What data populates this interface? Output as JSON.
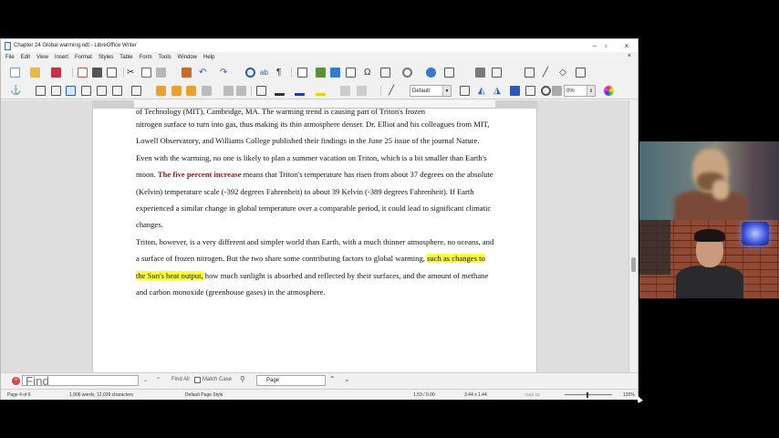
{
  "window": {
    "title": "Chapter 24 Global warming.odt - LibreOffice Writer"
  },
  "menu": [
    "File",
    "Edit",
    "View",
    "Insert",
    "Format",
    "Styles",
    "Table",
    "Form",
    "Tools",
    "Window",
    "Help"
  ],
  "toolbar": {
    "paragraph_style": "Default",
    "zoom_value": "0%"
  },
  "document": {
    "line_cut": "of Technology (MIT), Cambridge, MA. The warming trend is causing part of Triton's frozen",
    "p1": "nitrogen surface to turn into gas, thus making its thin atmosphere denser. Dr. Elliot and his colleagues from MIT, Lowell Observatory, and Williams College published their findings in the June 25 issue of the journal Nature.",
    "p2_a": "Even with the warming, no one is likely to plan a summer vacation on Triton, which is a bit smaller than Earth's moon. ",
    "p2_bold": "The five percent increase",
    "p2_b": " means that Triton's temperature has risen from about 37 degrees on the absolute (Kelvin) temperature scale (-392 degrees Fahrenheit) to about 39 Kelvin (-389 degrees Fahrenheit). If Earth experienced a similar change in global temperature over a comparable period, it could lead to significant climatic changes.",
    "p3_a": "Triton, however, is a very different and simpler world than Earth, with a much thinner atmosphere, no oceans, and a surface of frozen nitrogen. But the two share some contributing factors to global warming, ",
    "p3_hl": "such as changes to the Sun's heat output,",
    "p3_b": " how much sunlight is absorbed and reflected by their surfaces, and the amount of methane and carbon monoxide (greenhouse gases) in the atmosphere."
  },
  "findbar": {
    "placeholder": "Find",
    "find_all": "Find All",
    "match_case": "Match Case",
    "search_scope": "Page"
  },
  "statusbar": {
    "page": "Page 4 of 6",
    "counts": "1,906 words, 12,039 characters",
    "page_style": "Default Page Style",
    "cursor_pos": "1.53 / 0.00",
    "size": "3.44 x 1.44",
    "zoom": "120%"
  },
  "colors": {
    "highlight": "#ffff38",
    "bold_text": "#8b1a1a",
    "close_find": "#e0433a"
  }
}
